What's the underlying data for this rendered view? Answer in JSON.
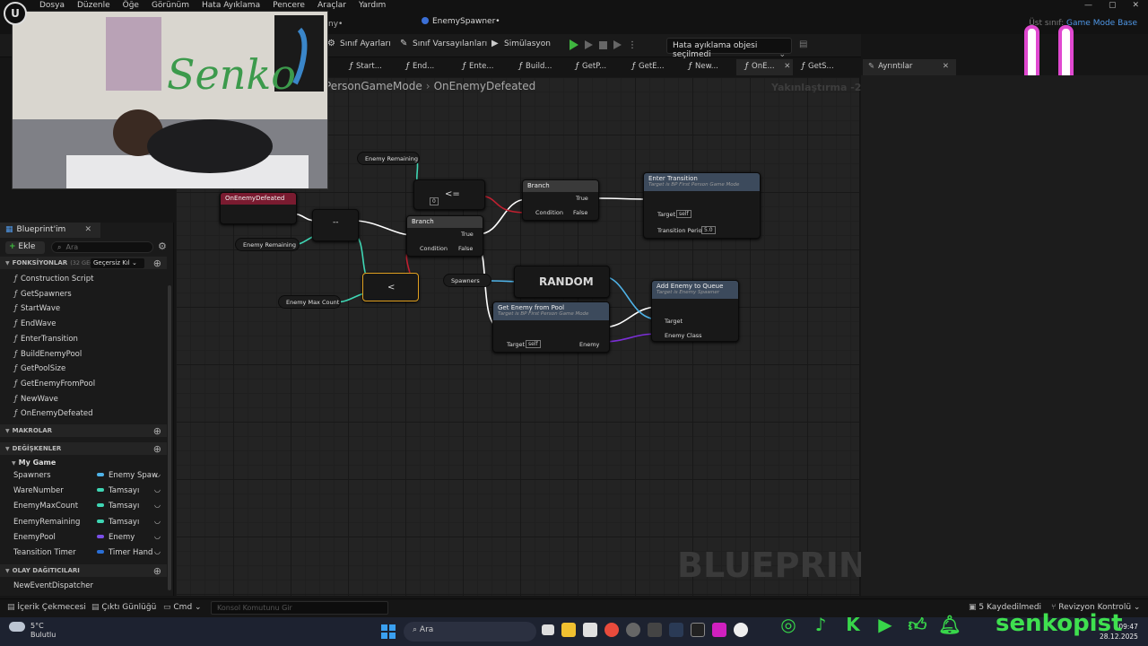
{
  "menu": [
    "Dosya",
    "Düzenle",
    "Öğe",
    "Görünüm",
    "Hata Ayıklama",
    "Pencere",
    "Araçlar",
    "Yardım"
  ],
  "tabs": {
    "partial": "ny•",
    "active": "EnemySpawner•"
  },
  "parent_class": {
    "label": "Üst sınıf:",
    "value": "Game Mode Base"
  },
  "toolbar": {
    "class_settings": "Sınıf Ayarları",
    "class_defaults": "Sınıf Varsayılanları",
    "simulation": "Simülasyon",
    "debug_object": "Hata ayıklama objesi seçilmedi"
  },
  "function_tabs": [
    "Start...",
    "End...",
    "Ente...",
    "Build...",
    "GetP...",
    "GetE...",
    "New...",
    "OnE...",
    "GetS..."
  ],
  "details_tab": "Ayrıntılar",
  "graph": {
    "breadcrumb_parent": "PersonGameMode",
    "breadcrumb_current": "OnEnemyDefeated",
    "zoom": "Yakınlaştırma -2",
    "watermark": "BLUEPRINT",
    "nodes": {
      "event": "OnEnemyDefeated",
      "enemy_remaining_get_1": "Enemy Remaining",
      "enemy_remaining_get_2": "Enemy Remaining",
      "enemy_max_count": "Enemy Max Count",
      "decrement": "--",
      "lte": "<=",
      "lte_value": "0",
      "lt": "<",
      "branch1": {
        "title": "Branch",
        "true": "True",
        "false": "False",
        "condition": "Condition"
      },
      "branch2": {
        "title": "Branch",
        "true": "True",
        "false": "False",
        "condition": "Condition"
      },
      "enter_transition": {
        "title": "Enter Transition",
        "sub": "Target is BP First Person Game Mode",
        "target": "Target",
        "self": "self",
        "period": "Transition Period",
        "period_value": "5.0"
      },
      "spawners": "Spawners",
      "random": "RANDOM",
      "get_enemy": {
        "title": "Get Enemy from Pool",
        "sub": "Target is BP First Person Game Mode",
        "target": "Target",
        "self": "self",
        "enemy": "Enemy"
      },
      "add_enemy": {
        "title": "Add Enemy to Queue",
        "sub": "Target is Enemy Spawner",
        "target": "Target",
        "enemy_class": "Enemy Class"
      }
    }
  },
  "left_panel": {
    "tab": "Blueprint'im",
    "add": "Ekle",
    "search_placeholder": "Ara",
    "functions_title": "FONKSİYONLAR",
    "functions_extra": "(32 GEÇE",
    "filter": "Geçersiz Kıl",
    "functions": [
      "Construction Script",
      "GetSpawners",
      "StartWave",
      "EndWave",
      "EnterTransition",
      "BuildEnemyPool",
      "GetPoolSize",
      "GetEnemyFromPool",
      "NewWave",
      "OnEnemyDefeated"
    ],
    "macros_title": "MAKROLAR",
    "variables_title": "DEĞİŞKENLER",
    "category": "My Game",
    "variables": [
      {
        "name": "Spawners",
        "type": "Enemy Spaw",
        "color": "#4fb3e8"
      },
      {
        "name": "WareNumber",
        "type": "Tamsayı",
        "color": "#3fd6b4"
      },
      {
        "name": "EnemyMaxCount",
        "type": "Tamsayı",
        "color": "#3fd6b4"
      },
      {
        "name": "EnemyRemaining",
        "type": "Tamsayı",
        "color": "#3fd6b4"
      },
      {
        "name": "EnemyPool",
        "type": "Enemy",
        "color": "#7b4fe8"
      },
      {
        "name": "Teansition Timer",
        "type": "Timer Hand",
        "color": "#2a6fd6"
      }
    ],
    "dispatchers_title": "OLAY DAĞITICILARI",
    "dispatchers": [
      "NewEventDispatcher"
    ]
  },
  "statusbar": {
    "content_drawer": "İçerik Çekmecesi",
    "output_log": "Çıktı Günlüğü",
    "cmd": "Cmd",
    "console_placeholder": "Konsol Komutunu Gir",
    "saved": "5 Kaydedilmedi",
    "revision": "Revizyon Kontrolü"
  },
  "taskbar": {
    "temp": "5°C",
    "weather": "Bulutlu",
    "search": "Ara",
    "time": "09:47",
    "date": "28.12.2025"
  },
  "overlay": {
    "brand": "senkopist",
    "webcam_sign": "Senko"
  }
}
